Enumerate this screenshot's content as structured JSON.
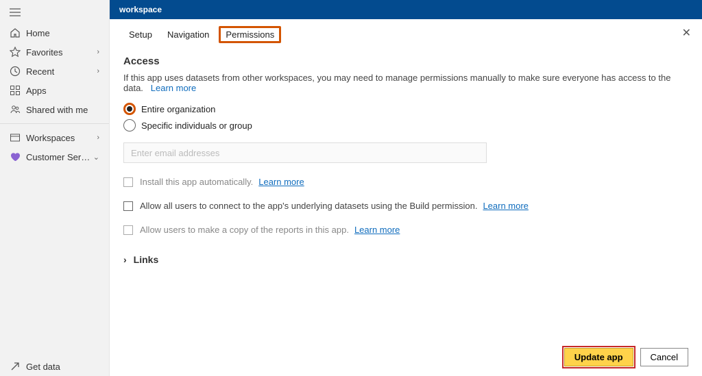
{
  "sidebar": {
    "items": [
      {
        "label": "Home"
      },
      {
        "label": "Favorites"
      },
      {
        "label": "Recent"
      },
      {
        "label": "Apps"
      },
      {
        "label": "Shared with me"
      },
      {
        "label": "Workspaces"
      },
      {
        "label": "Customer Service A..."
      }
    ],
    "getData": "Get data"
  },
  "header": {
    "title": "workspace"
  },
  "tabs": {
    "setup": "Setup",
    "navigation": "Navigation",
    "permissions": "Permissions"
  },
  "access": {
    "title": "Access",
    "desc": "If this app uses datasets from other workspaces, you may need to manage permissions manually to make sure everyone has access to the data.",
    "learn": "Learn more",
    "radio1": "Entire organization",
    "radio2": "Specific individuals or group",
    "emailPlaceholder": "Enter email addresses",
    "check1": "Install this app automatically.",
    "check2": "Allow all users to connect to the app's underlying datasets using the Build permission.",
    "check3": "Allow users to make a copy of the reports in this app.",
    "linksHeader": "Links"
  },
  "footer": {
    "update": "Update app",
    "cancel": "Cancel"
  }
}
